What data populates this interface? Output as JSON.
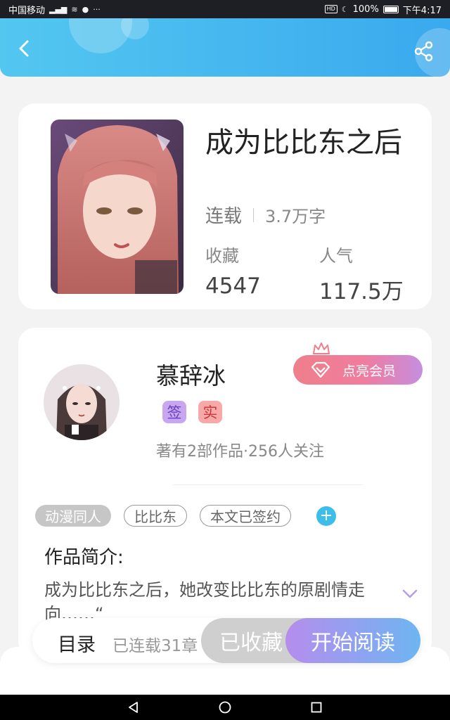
{
  "status_bar": {
    "carrier": "中国移动",
    "signal": "4G",
    "battery": "100%",
    "time": "下午4:17"
  },
  "book": {
    "title": "成为比比东之后",
    "status": "连载",
    "word_count": "3.7万字",
    "favorites_label": "收藏",
    "favorites_value": "4547",
    "popularity_label": "人气",
    "popularity_value": "117.5万"
  },
  "author": {
    "name": "慕辞冰",
    "vip_label": "点亮会员",
    "badge_sign": "签",
    "badge_real": "实",
    "stats": "著有2部作品·256人关注"
  },
  "tags": [
    "动漫同人",
    "比比东",
    "本文已签约"
  ],
  "intro": {
    "title": "作品简介:",
    "text": "成为比比东之后，她改变比比东的原剧情走向……“"
  },
  "bottom_bar": {
    "toc_label": "目录",
    "toc_count": "已连载31章",
    "favorited_label": "已收藏",
    "read_label": "开始阅读"
  },
  "colors": {
    "header_start": "#53c7f0",
    "header_end": "#3aa9ee",
    "vip_start": "#ef7f8a",
    "vip_end": "#c58ee0",
    "read_start": "#b58ded",
    "read_end": "#6eb5f2",
    "add_tag": "#3fbde9"
  },
  "icons": [
    "back-arrow-icon",
    "share-icon",
    "crown-icon",
    "diamond-icon",
    "plus-icon",
    "chevron-down-icon"
  ]
}
